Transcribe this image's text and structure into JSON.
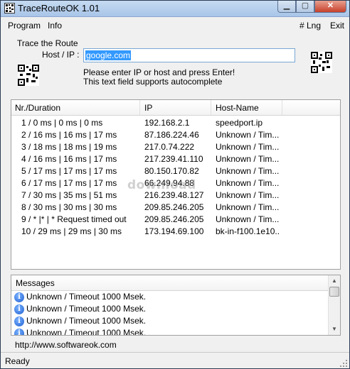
{
  "window": {
    "title": "TraceRouteOK 1.01"
  },
  "menu": {
    "program": "Program",
    "info": "Info",
    "lng": "# Lng",
    "exit": "Exit"
  },
  "trace": {
    "group_label": "Trace the Route",
    "host_label": "Host / IP :",
    "host_value": "google.com",
    "hint_line1": "Please enter IP or host and press Enter!",
    "hint_line2": "This text field supports autocomplete"
  },
  "results": {
    "columns": [
      "Nr./Duration",
      "IP",
      "Host-Name"
    ],
    "rows": [
      [
        "1 / 0 ms | 0 ms | 0 ms",
        "192.168.2.1",
        "speedport.ip"
      ],
      [
        "2 / 16 ms | 16 ms | 17 ms",
        "87.186.224.46",
        "Unknown / Tim..."
      ],
      [
        "3 / 18 ms | 18 ms | 19 ms",
        "217.0.74.222",
        "Unknown / Tim..."
      ],
      [
        "4 / 16 ms | 16 ms | 17 ms",
        "217.239.41.110",
        "Unknown / Tim..."
      ],
      [
        "5 / 17 ms | 17 ms | 17 ms",
        "80.150.170.82",
        "Unknown / Tim..."
      ],
      [
        "6 / 17 ms | 17 ms | 17 ms",
        "66.249.94.88",
        "Unknown / Tim..."
      ],
      [
        "7 / 30 ms | 35 ms | 51 ms",
        "216.239.48.127",
        "Unknown / Tim..."
      ],
      [
        "8 / 30 ms | 30 ms | 30 ms",
        "209.85.246.205",
        "Unknown / Tim..."
      ],
      [
        "9 / * |* | * Request timed out",
        "209.85.246.205",
        "Unknown / Tim..."
      ],
      [
        "10 / 29 ms | 29 ms | 30 ms",
        "173.194.69.100",
        "bk-in-f100.1e10..."
      ]
    ]
  },
  "messages": {
    "header": "Messages",
    "items": [
      "Unknown / Timeout 1000 Msek.",
      "Unknown / Timeout 1000 Msek.",
      "Unknown / Timeout 1000 Msek.",
      "Unknown / Timeout 1000 Msek."
    ],
    "icon": "info-icon"
  },
  "footer": {
    "url": "http://www.softwareok.com"
  },
  "status": {
    "text": "Ready"
  },
  "watermark": "download"
}
